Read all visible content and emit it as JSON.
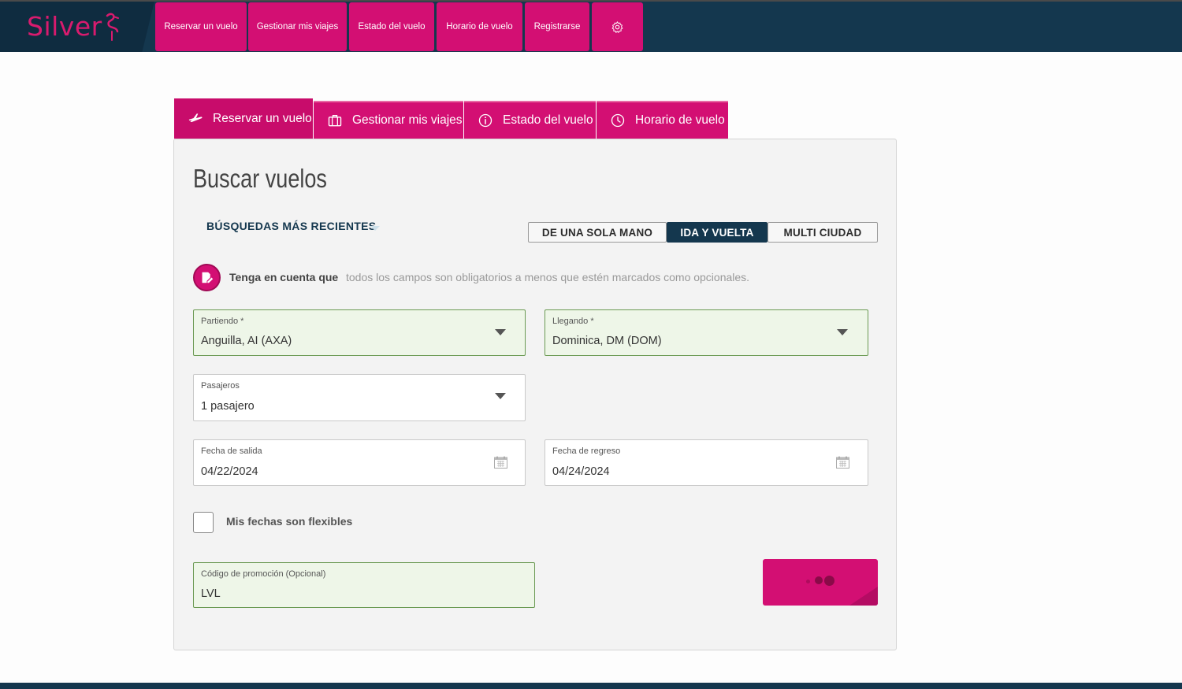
{
  "brand": {
    "logo_text": "Silver",
    "accent": "#d30f73",
    "navy": "#14374e",
    "valid_bg": "#eef6e8"
  },
  "topnav": {
    "items": [
      {
        "label": "Reservar un vuelo"
      },
      {
        "label": "Gestionar mis viajes"
      },
      {
        "label": "Estado del vuelo"
      },
      {
        "label": "Horario de vuelo"
      },
      {
        "label": "Registrarse"
      }
    ],
    "settings_icon": "gear-icon"
  },
  "tabs": [
    {
      "label": "Reservar un vuelo",
      "icon": "plane-icon",
      "active": true
    },
    {
      "label": "Gestionar mis viajes",
      "icon": "briefcase-icon",
      "active": false
    },
    {
      "label": "Estado del vuelo",
      "icon": "info-icon",
      "active": false
    },
    {
      "label": "Horario de vuelo",
      "icon": "clock-icon",
      "active": false
    }
  ],
  "search": {
    "title": "Buscar vuelos",
    "recent_label": "BÚSQUEDAS MÁS RECIENTES",
    "trip_types": [
      {
        "label": "DE UNA SOLA MANO",
        "selected": false
      },
      {
        "label": "IDA Y VUELTA",
        "selected": true
      },
      {
        "label": "MULTI CIUDAD",
        "selected": false
      }
    ],
    "notice": {
      "strong": "Tenga en cuenta que",
      "text": "todos los campos son obligatorios a menos que estén marcados como opcionales."
    },
    "origin": {
      "label": "Partiendo *",
      "value": "Anguilla, AI (AXA)"
    },
    "destination": {
      "label": "Llegando *",
      "value": "Dominica, DM (DOM)"
    },
    "passengers": {
      "label": "Pasajeros",
      "value": "1 pasajero"
    },
    "depart_date": {
      "label": "Fecha de salida",
      "value": "04/22/2024"
    },
    "return_date": {
      "label": "Fecha de regreso",
      "value": "04/24/2024"
    },
    "flexible": {
      "label": "Mis fechas son flexibles",
      "checked": false
    },
    "promo": {
      "label": "Código de promoción (Opcional)",
      "value": "LVL"
    },
    "submit_state": "loading"
  }
}
